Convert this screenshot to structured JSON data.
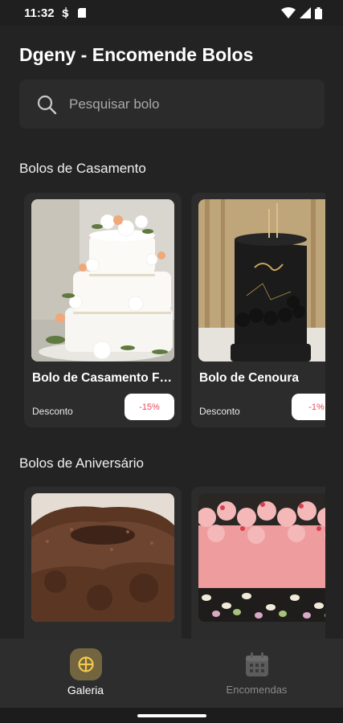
{
  "status_bar": {
    "time": "11:32",
    "icons": [
      "s-notification-icon",
      "sd-card-icon",
      "wifi-icon",
      "signal-icon",
      "battery-icon"
    ]
  },
  "app": {
    "title": "Dgeny - Encomende Bolos"
  },
  "search": {
    "placeholder": "Pesquisar bolo",
    "value": ""
  },
  "sections": [
    {
      "title": "Bolos de Casamento",
      "items": [
        {
          "name": "Bolo de Casamento Floral",
          "discount_label": "Desconto",
          "discount": "-15%"
        },
        {
          "name": "Bolo de Cenoura",
          "discount_label": "Desconto",
          "discount": "-1%"
        }
      ]
    },
    {
      "title": "Bolos de Aniversário",
      "items": [
        {
          "name": ""
        },
        {
          "name": ""
        }
      ]
    }
  ],
  "bottom_nav": {
    "items": [
      {
        "label": "Galeria",
        "icon": "gallery-icon",
        "active": true
      },
      {
        "label": "Encomendas",
        "icon": "calendar-icon",
        "active": false
      }
    ]
  },
  "colors": {
    "background": "#232323",
    "card": "#2c2c2c",
    "accent": "#726540",
    "discount": "#e74a59"
  }
}
